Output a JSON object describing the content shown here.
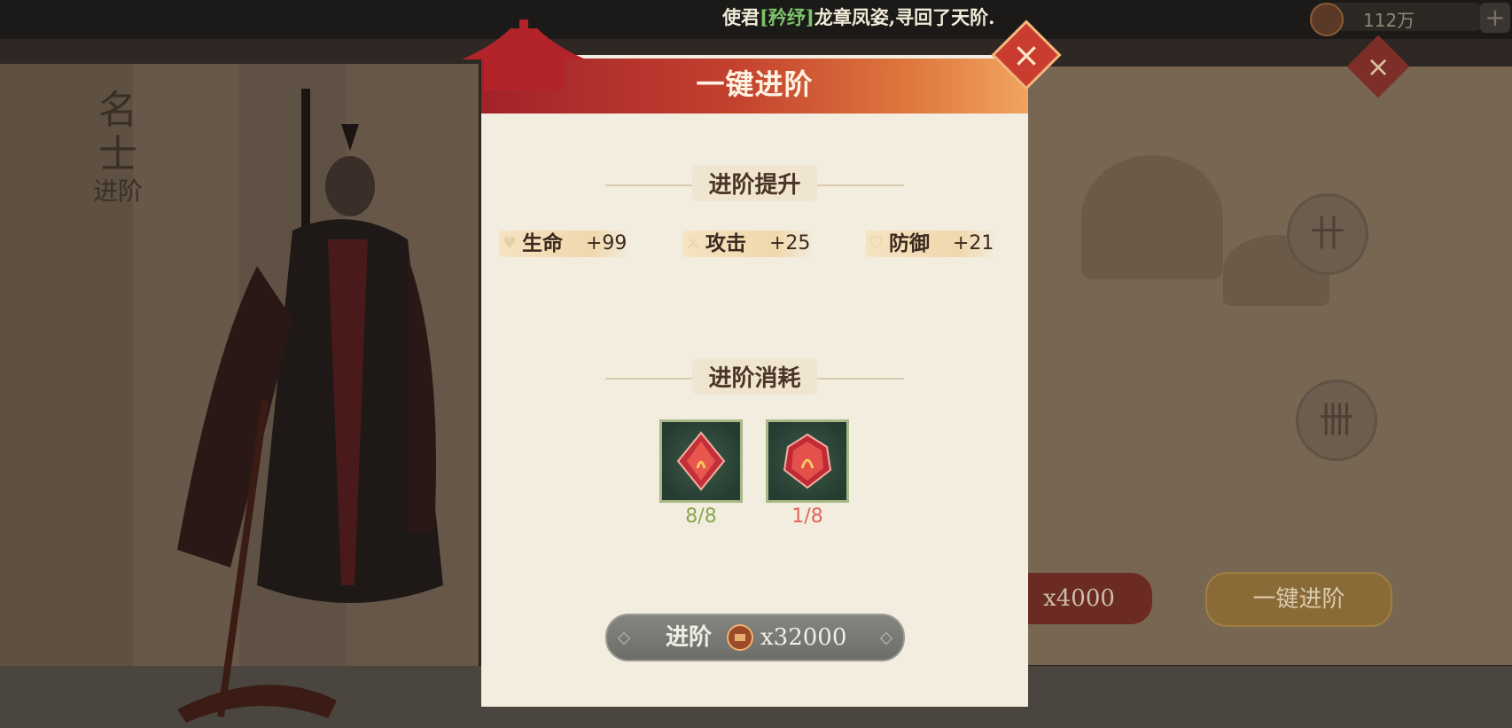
{
  "banner": {
    "prefix": "使君",
    "highlight": "[矜纾]",
    "suffix": "龙章凤姿,寻回了天阶."
  },
  "currency": {
    "amount": "112万",
    "plus": "+"
  },
  "side_title": {
    "line1": "名",
    "line2": "士",
    "line3": "进阶"
  },
  "background": {
    "cost_amount": "x4000",
    "onekey_label": "一键进阶"
  },
  "dialog": {
    "title": "一键进阶",
    "close": "×",
    "upgrade_section": "进阶提升",
    "stats": [
      {
        "name": "生命",
        "value": "+99",
        "icon": "heart-icon"
      },
      {
        "name": "攻击",
        "value": "+25",
        "icon": "sword-icon"
      },
      {
        "name": "防御",
        "value": "+21",
        "icon": "shield-icon"
      }
    ],
    "cost_section": "进阶消耗",
    "items": [
      {
        "icon": "red-diamond-gem-icon",
        "count": "8/8",
        "sufficient": true
      },
      {
        "icon": "red-crystal-gem-icon",
        "count": "1/8",
        "sufficient": false
      }
    ],
    "advance_button": {
      "label": "进阶",
      "amount": "x32000"
    }
  },
  "colors": {
    "header_red": "#a1222a",
    "header_orange": "#f0a560",
    "count_ok": "#89a74f",
    "count_bad": "#e2645a",
    "panel_bg": "#f3ede0"
  }
}
